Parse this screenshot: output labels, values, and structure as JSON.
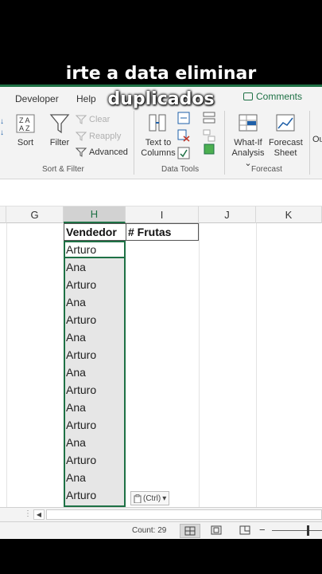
{
  "caption": {
    "line1": "irte a data eliminar",
    "line2": "duplicados"
  },
  "ribbon": {
    "tabs": {
      "developer": "Developer",
      "help": "Help",
      "comments": "Comments"
    },
    "sort_filter": {
      "sort_label": "Sort",
      "filter_label": "Filter",
      "clear_label": "Clear",
      "reapply_label": "Reapply",
      "advanced_label": "Advanced",
      "group_label": "Sort & Filter"
    },
    "data_tools": {
      "text_to_columns_line1": "Text to",
      "text_to_columns_line2": "Columns",
      "group_label": "Data Tools"
    },
    "forecast": {
      "what_if_line1": "What-If",
      "what_if_line2": "Analysis",
      "forecast_sheet_line1": "Forecast",
      "forecast_sheet_line2": "Sheet",
      "group_label": "Forecast",
      "outline_partial": "Ou"
    }
  },
  "columns": [
    "G",
    "H",
    "I",
    "J",
    "K"
  ],
  "headers": {
    "h": "Vendedor",
    "i": "# Frutas"
  },
  "rows": [
    "Arturo",
    "Ana",
    "Arturo",
    "Ana",
    "Arturo",
    "Ana",
    "Arturo",
    "Ana",
    "Arturo",
    "Ana",
    "Arturo",
    "Ana",
    "Arturo",
    "Ana",
    "Arturo"
  ],
  "paste_options": "(Ctrl)",
  "status": {
    "count": "Count: 29"
  },
  "colors": {
    "accent": "#1e7145"
  }
}
